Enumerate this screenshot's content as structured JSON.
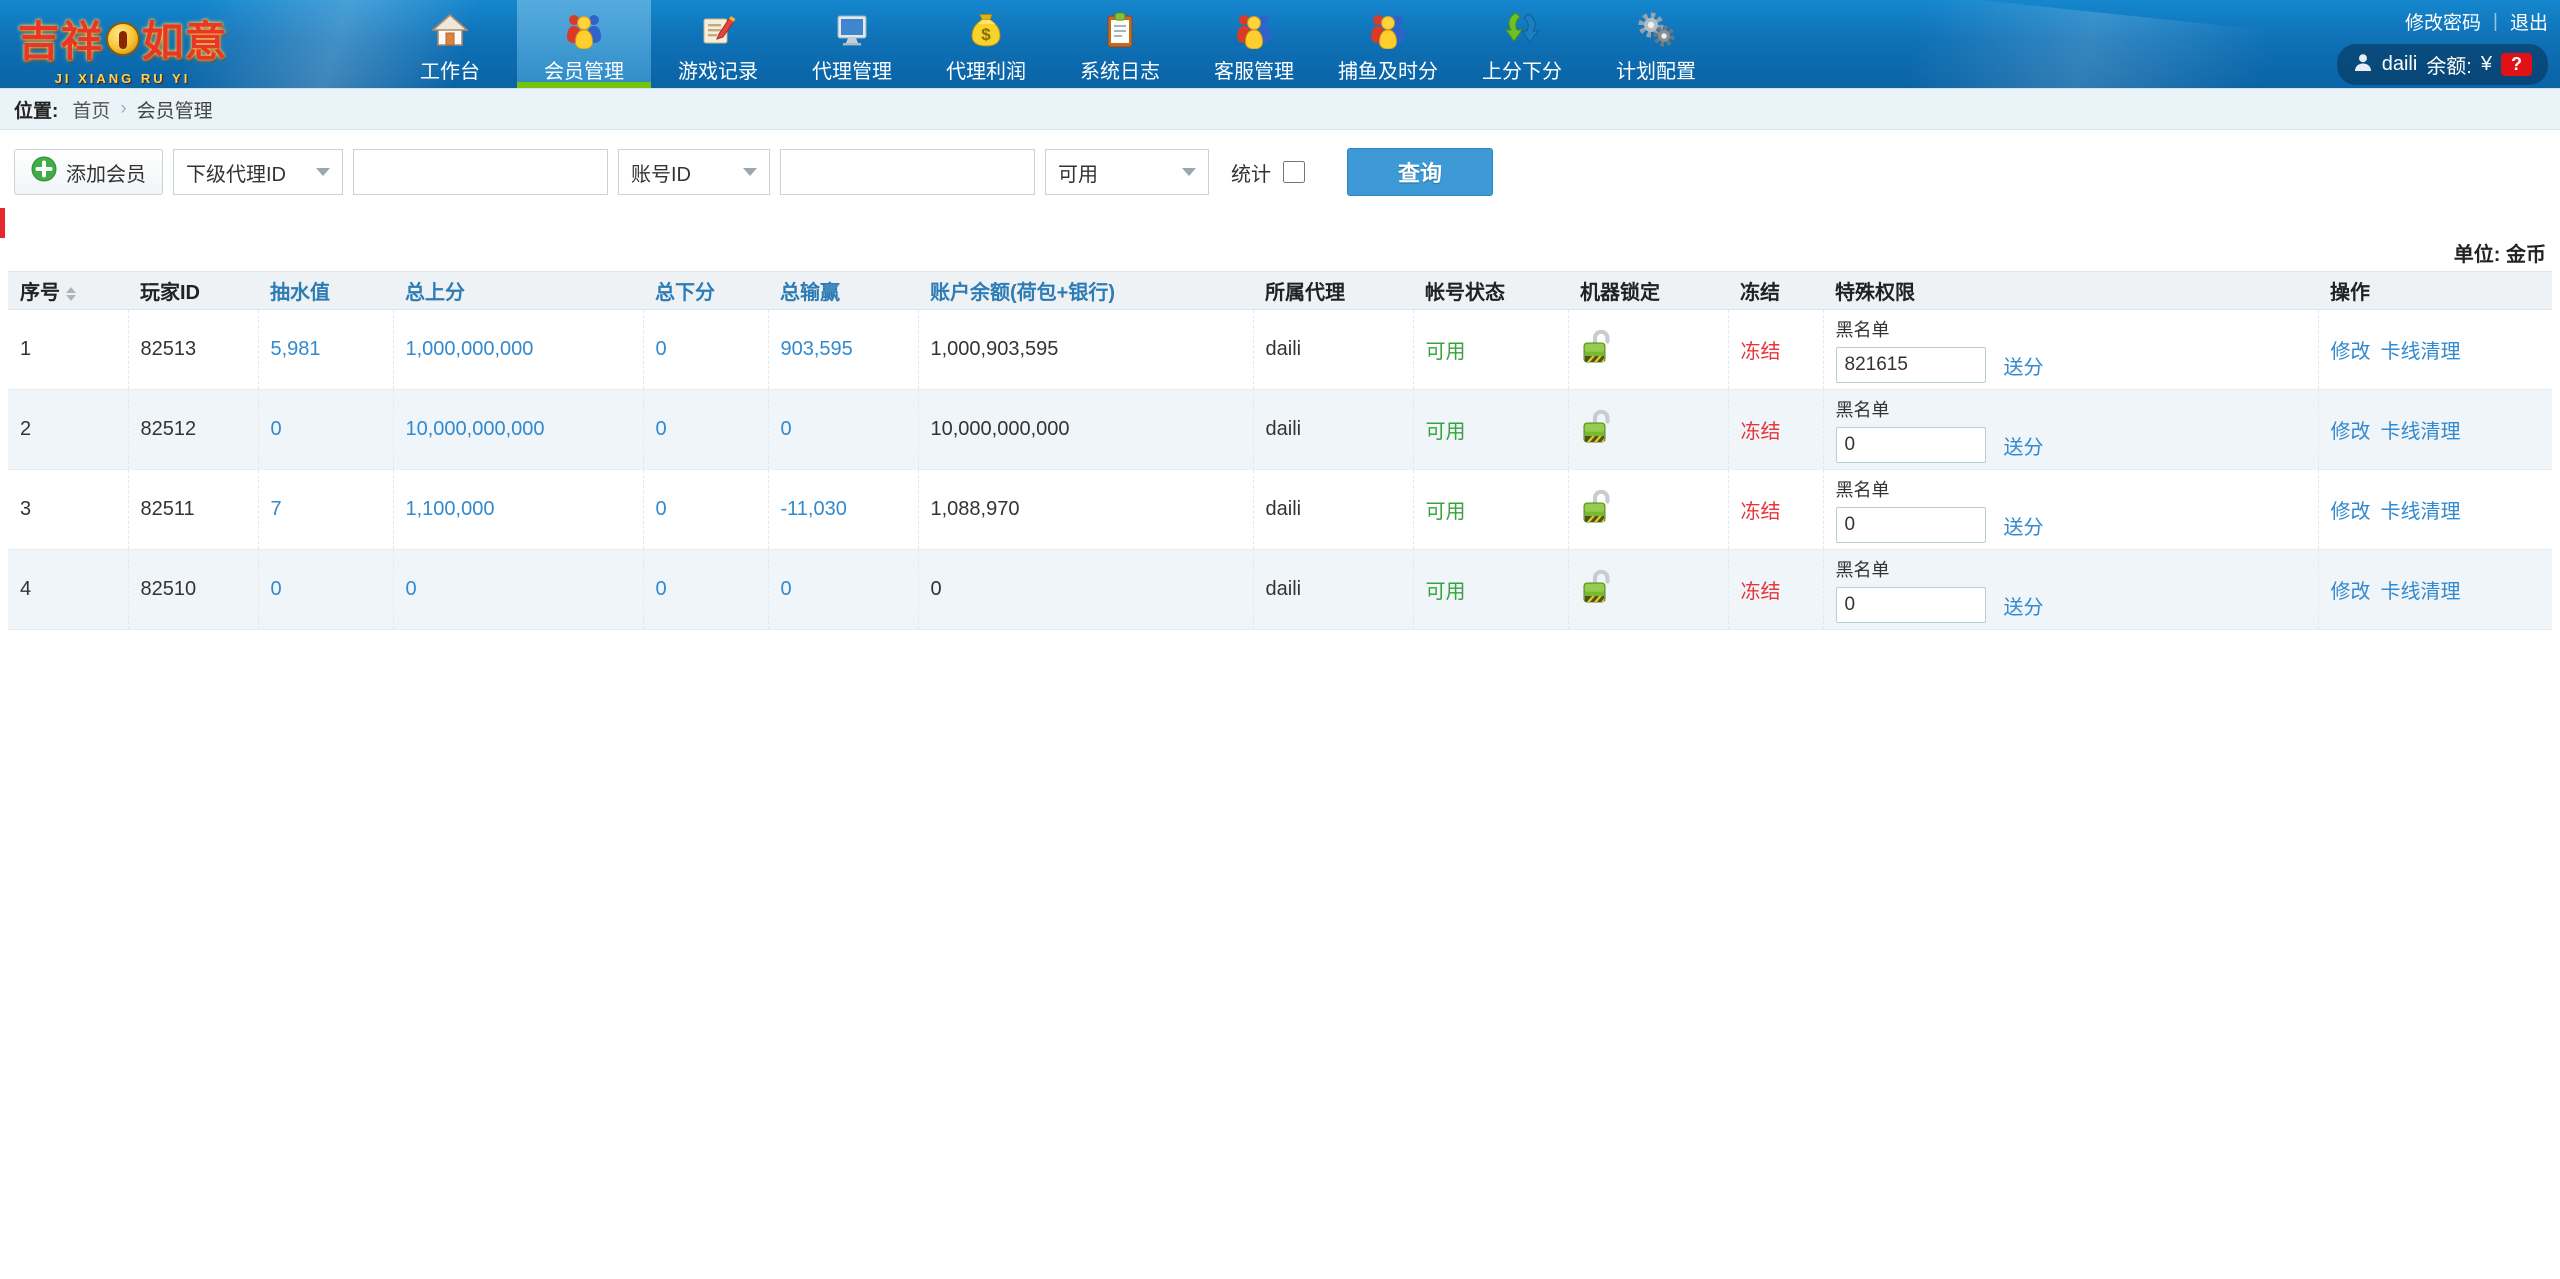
{
  "brand": {
    "title_left": "吉祥",
    "title_right": "如意",
    "subtitle": "JI XIANG RU YI",
    "ornament_icon": "gold-medallion-icon"
  },
  "topbar": {
    "change_password": "修改密码",
    "divider": "|",
    "logout": "退出",
    "user_icon": "user-icon",
    "username": "daili",
    "balance_label": "余额:",
    "currency": "¥",
    "balance_badge": "?",
    "badge_color": "#e01216"
  },
  "nav": {
    "active_index": 1,
    "active_underline_color": "#74c30e",
    "items": [
      {
        "label": "工作台",
        "icon": "home-icon",
        "active": false
      },
      {
        "label": "会员管理",
        "icon": "members-icon",
        "active": true
      },
      {
        "label": "游戏记录",
        "icon": "game-records-icon",
        "active": false
      },
      {
        "label": "代理管理",
        "icon": "agent-management-icon",
        "active": false
      },
      {
        "label": "代理利润",
        "icon": "agent-profit-icon",
        "active": false
      },
      {
        "label": "系统日志",
        "icon": "system-log-icon",
        "active": false
      },
      {
        "label": "客服管理",
        "icon": "customer-service-icon",
        "active": false
      },
      {
        "label": "捕鱼及时分",
        "icon": "fishing-points-icon",
        "active": false
      },
      {
        "label": "上分下分",
        "icon": "score-updown-icon",
        "active": false
      },
      {
        "label": "计划配置",
        "icon": "plan-config-icon",
        "active": false
      }
    ]
  },
  "breadcrumb": {
    "prefix": "位置:",
    "home": "首页",
    "separator": "›",
    "current": "会员管理"
  },
  "toolbar": {
    "add_member": "添加会员",
    "add_icon": "plus-icon",
    "filter1_selected": "下级代理ID",
    "input1_value": "",
    "filter2_selected": "账号ID",
    "input2_value": "",
    "status_selected": "可用",
    "stats_label": "统计",
    "stats_checked": false,
    "search_label": "查询",
    "search_color": "#3d9ad6"
  },
  "notice": {
    "accent_color": "#e8262d"
  },
  "unit_label": "单位: 金币",
  "table": {
    "columns": [
      {
        "label": "序号",
        "blue": false,
        "sortable": true
      },
      {
        "label": "玩家ID",
        "blue": false
      },
      {
        "label": "抽水值",
        "blue": true
      },
      {
        "label": "总上分",
        "blue": true
      },
      {
        "label": "总下分",
        "blue": true
      },
      {
        "label": "总输赢",
        "blue": true
      },
      {
        "label": "账户余额(荷包+银行)",
        "blue": true
      },
      {
        "label": "所属代理",
        "blue": false
      },
      {
        "label": "帐号状态",
        "blue": false
      },
      {
        "label": "机器锁定",
        "blue": false
      },
      {
        "label": "冻结",
        "blue": false
      },
      {
        "label": "特殊权限",
        "blue": false
      },
      {
        "label": "操作",
        "blue": false
      }
    ],
    "lock_icon": "lock-open-icon",
    "rows": [
      {
        "seq": "1",
        "player_id": "82513",
        "pump": "5,981",
        "total_up": "1,000,000,000",
        "total_down": "0",
        "total_winloss": "903,595",
        "balance": "1,000,903,595",
        "agent": "daili",
        "status": "可用",
        "freeze_link": "冻结",
        "blacklist_label": "黑名单",
        "score_input": "821615",
        "send_link": "送分",
        "action_edit": "修改",
        "action_clear": "卡线清理"
      },
      {
        "seq": "2",
        "player_id": "82512",
        "pump": "0",
        "total_up": "10,000,000,000",
        "total_down": "0",
        "total_winloss": "0",
        "balance": "10,000,000,000",
        "agent": "daili",
        "status": "可用",
        "freeze_link": "冻结",
        "blacklist_label": "黑名单",
        "score_input": "0",
        "send_link": "送分",
        "action_edit": "修改",
        "action_clear": "卡线清理"
      },
      {
        "seq": "3",
        "player_id": "82511",
        "pump": "7",
        "total_up": "1,100,000",
        "total_down": "0",
        "total_winloss": "-11,030",
        "balance": "1,088,970",
        "agent": "daili",
        "status": "可用",
        "freeze_link": "冻结",
        "blacklist_label": "黑名单",
        "score_input": "0",
        "send_link": "送分",
        "action_edit": "修改",
        "action_clear": "卡线清理"
      },
      {
        "seq": "4",
        "player_id": "82510",
        "pump": "0",
        "total_up": "0",
        "total_down": "0",
        "total_winloss": "0",
        "balance": "0",
        "agent": "daili",
        "status": "可用",
        "freeze_link": "冻结",
        "blacklist_label": "黑名单",
        "score_input": "0",
        "send_link": "送分",
        "action_edit": "修改",
        "action_clear": "卡线清理"
      }
    ]
  },
  "colors": {
    "nav_blue": "#0f71b6",
    "active_tab": "#2f8cc7",
    "link_blue": "#3389cd",
    "status_green": "#39a23c",
    "freeze_red": "#e8353a",
    "header_bg": "#eef2f5",
    "alt_row": "#f0f5f9"
  }
}
